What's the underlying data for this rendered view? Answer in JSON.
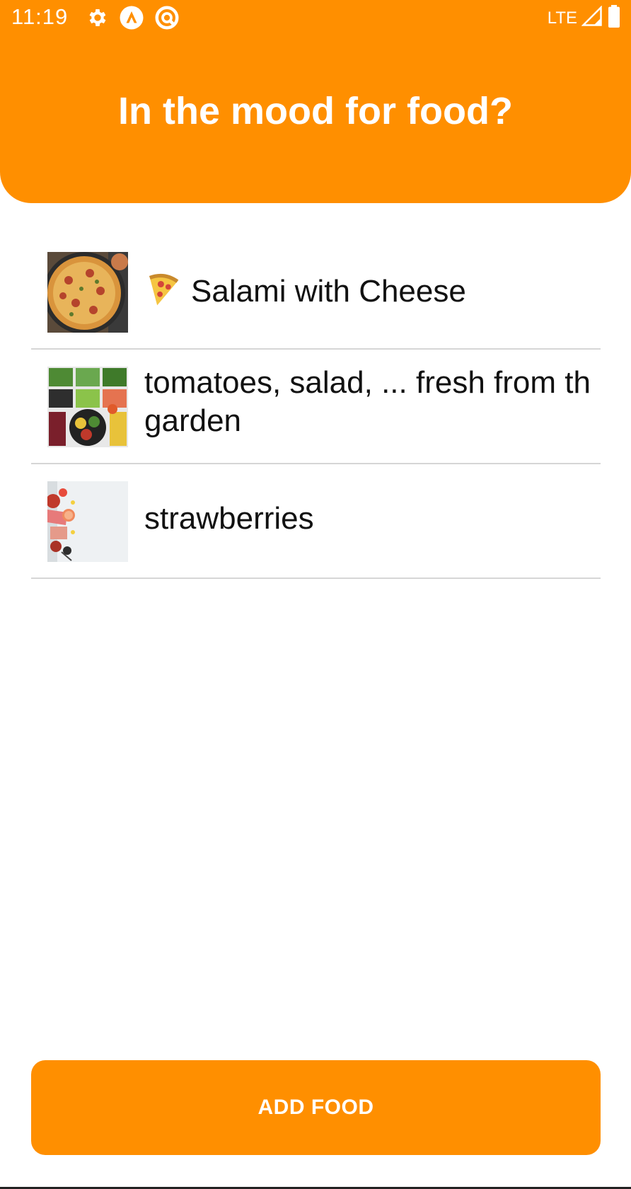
{
  "status_bar": {
    "time": "11:19",
    "network": "LTE",
    "icons": [
      "gear-icon",
      "app-a-icon",
      "app-q-icon",
      "signal-icon",
      "battery-icon"
    ]
  },
  "header": {
    "title": "In the mood for food?",
    "background_color": "#FF8F00"
  },
  "foods": [
    {
      "label": "Salami with Cheese",
      "emoji": "pizza-icon",
      "image": "pizza-thumbnail"
    },
    {
      "label_line1": "tomatoes, salad, ... fresh from th",
      "label_line2": "garden",
      "image": "vegetables-thumbnail"
    },
    {
      "label": "strawberries",
      "image": "strawberries-thumbnail"
    }
  ],
  "actions": {
    "add_label": "ADD FOOD"
  },
  "colors": {
    "accent": "#FF8F00",
    "divider": "#d6d6d6"
  }
}
